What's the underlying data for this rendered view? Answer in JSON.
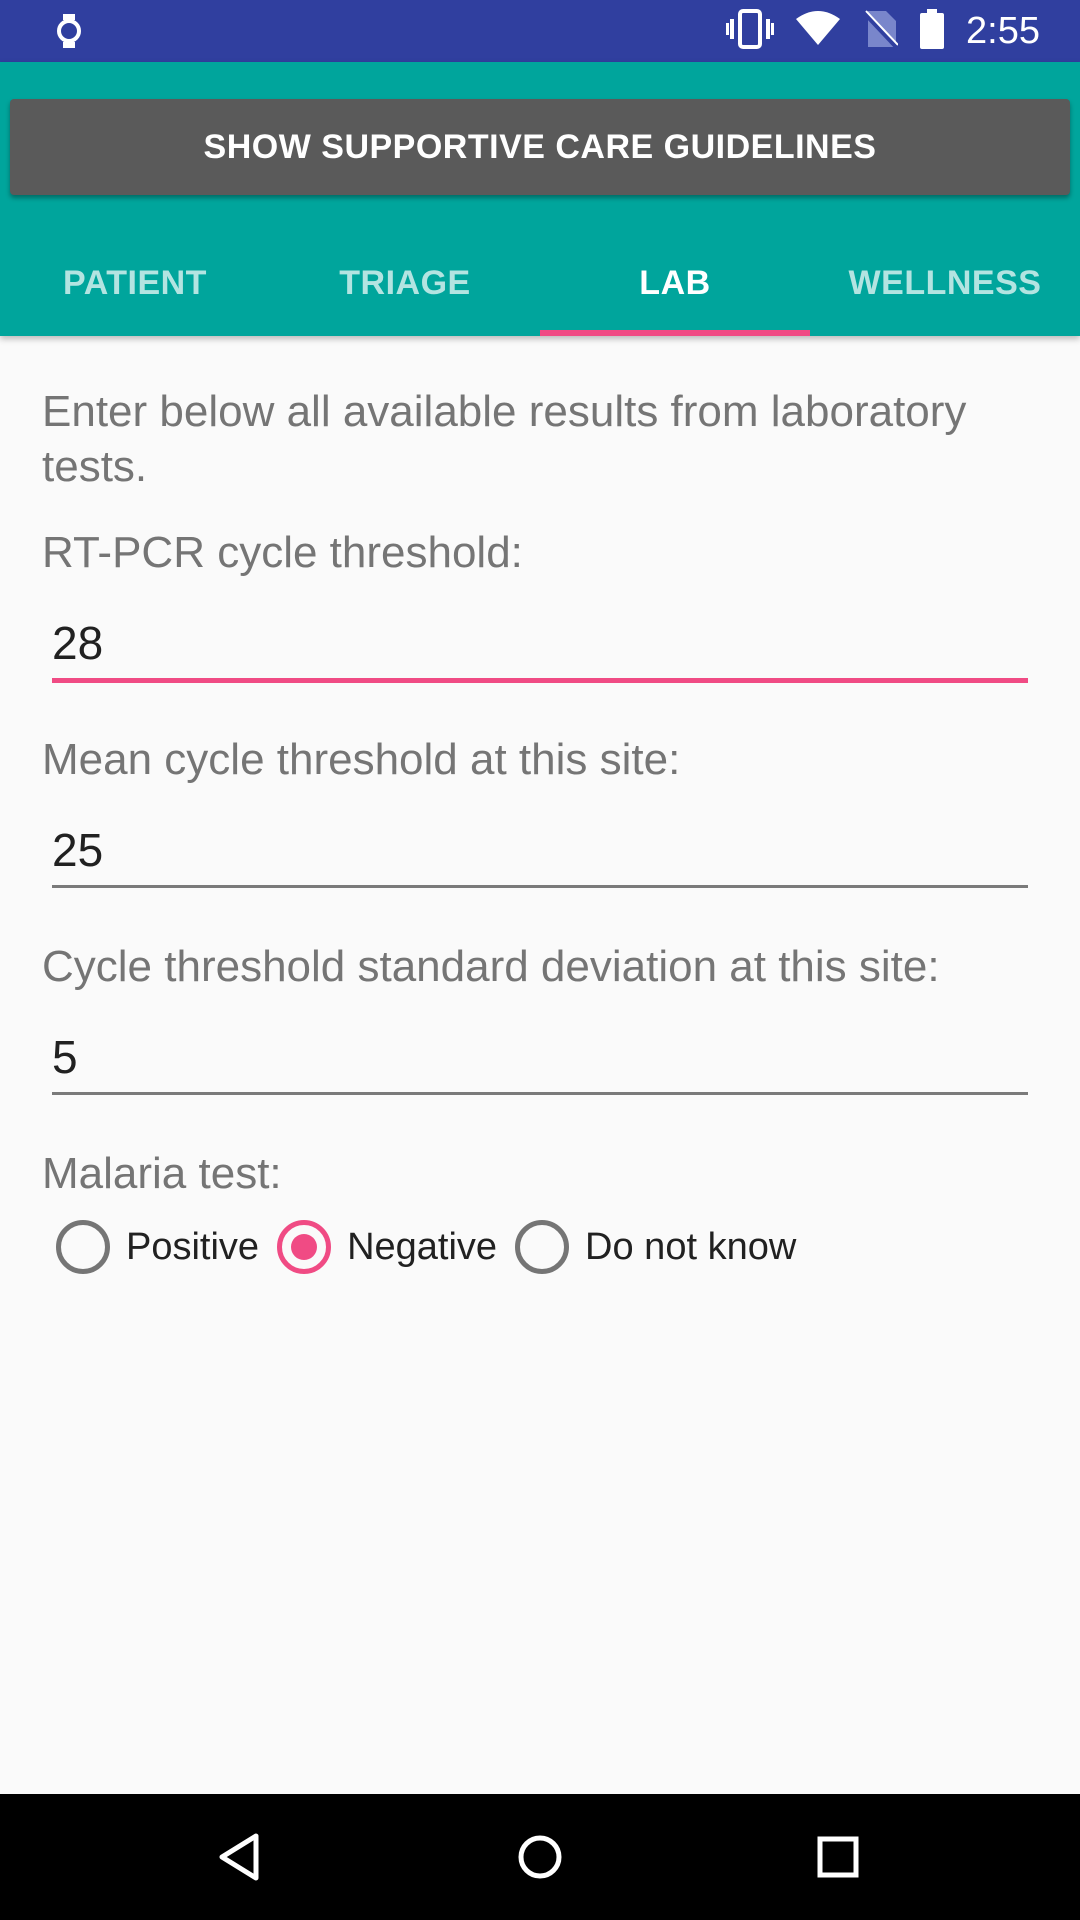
{
  "status_bar": {
    "time": "2:55",
    "icons": [
      "watch-icon",
      "vibrate-icon",
      "wifi-icon",
      "no-sim-icon",
      "battery-icon"
    ]
  },
  "header": {
    "guidelines_button": "SHOW SUPPORTIVE CARE GUIDELINES",
    "tabs": [
      {
        "label": "PATIENT",
        "active": false
      },
      {
        "label": "TRIAGE",
        "active": false
      },
      {
        "label": "LAB",
        "active": true
      },
      {
        "label": "WELLNESS",
        "active": false
      }
    ]
  },
  "content": {
    "intro": "Enter below all available results from laboratory tests.",
    "fields": [
      {
        "label": "RT-PCR cycle threshold:",
        "value": "28"
      },
      {
        "label": "Mean cycle threshold at this site:",
        "value": "25"
      },
      {
        "label": "Cycle threshold standard deviation at this site:",
        "value": "5"
      }
    ],
    "malaria": {
      "label": "Malaria test:",
      "options": [
        "Positive",
        "Negative",
        "Do not know"
      ],
      "selected": "Negative"
    }
  },
  "colors": {
    "status_bar": "#303f9f",
    "header": "#00a59c",
    "accent": "#f04b84",
    "button": "#5a5a5a"
  },
  "nav_bar": {
    "icons": [
      "back-icon",
      "home-icon",
      "recents-icon"
    ]
  }
}
